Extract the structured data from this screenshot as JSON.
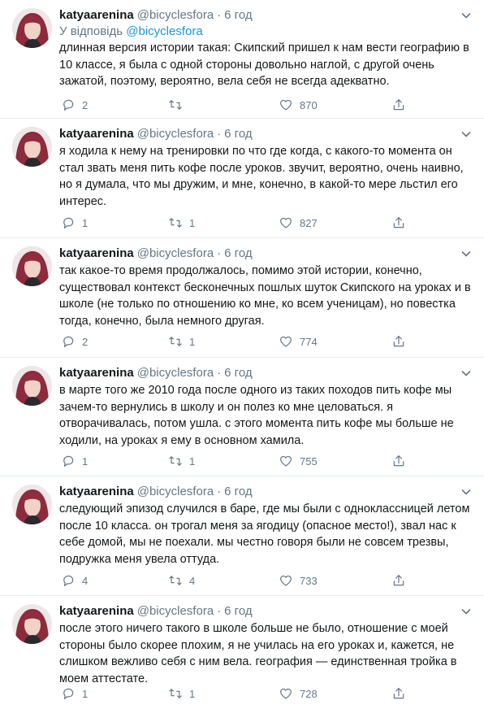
{
  "tweets": [
    {
      "name": "katyaarenina",
      "handle": "@bicyclesfora",
      "dot": "·",
      "time": "6 год",
      "reply_prefix": "У відповідь ",
      "reply_handle": "@bicyclesfora",
      "text": "длинная версия истории такая: Скипский пришел к нам вести географию в 10 классе, я была с одной стороны довольно наглой, с другой очень зажатой, поэтому, вероятно, вела себя не всегда адекватно.",
      "replies": "2",
      "retweets": "",
      "likes": "870"
    },
    {
      "name": "katyaarenina",
      "handle": "@bicyclesfora",
      "dot": "·",
      "time": "6 год",
      "text": "я ходила к нему на тренировки по что где когда, с какого-то момента он стал звать меня пить кофе после уроков. звучит, вероятно, очень наивно, но я думала, что мы дружим, и мне, конечно, в какой-то мере льстил его интерес.",
      "replies": "1",
      "retweets": "1",
      "likes": "827"
    },
    {
      "name": "katyaarenina",
      "handle": "@bicyclesfora",
      "dot": "·",
      "time": "6 год",
      "text": "так какое-то время продолжалось, помимо этой истории, конечно, существовал контекст бесконечных пошлых шуток Скипского на уроках и в школе (не только по отношению ко мне, ко всем ученицам), но повестка тогда, конечно, была немного другая.",
      "replies": "2",
      "retweets": "1",
      "likes": "774"
    },
    {
      "name": "katyaarenina",
      "handle": "@bicyclesfora",
      "dot": "·",
      "time": "6 год",
      "text": "в марте того же 2010 года после одного из таких походов пить кофе мы зачем-то вернулись в школу и он полез ко мне целоваться. я отворачивалась, потом ушла. с этого момента пить кофе мы больше не ходили, на уроках я ему в основном хамила.",
      "replies": "1",
      "retweets": "1",
      "likes": "755"
    },
    {
      "name": "katyaarenina",
      "handle": "@bicyclesfora",
      "dot": "·",
      "time": "6 год",
      "text": "следующий эпизод случился в баре, где мы были с одноклассницей летом после 10 класса. он трогал меня за ягодицу (опасное место!), звал нас к себе домой, мы не поехали. мы честно говоря были не совсем трезвы, подружка меня увела оттуда.",
      "replies": "4",
      "retweets": "4",
      "likes": "733"
    },
    {
      "name": "katyaarenina",
      "handle": "@bicyclesfora",
      "dot": "·",
      "time": "6 год",
      "text": "после этого ничего такого в школе больше не было, отношение с моей стороны было скорее плохим, я не училась на его уроках и, кажется, не слишком вежливо себя с ним вела. география — единственная тройка в моем аттестате.",
      "replies": "1",
      "retweets": "1",
      "likes": "728"
    }
  ],
  "icons": {
    "reply": "reply-icon",
    "retweet": "retweet-icon",
    "like": "heart-icon",
    "share": "share-icon",
    "more": "chevron-down-icon"
  },
  "colors": {
    "text": "#14171a",
    "secondary": "#657786",
    "link": "#1b95e0",
    "divider": "#e6ecf0"
  }
}
